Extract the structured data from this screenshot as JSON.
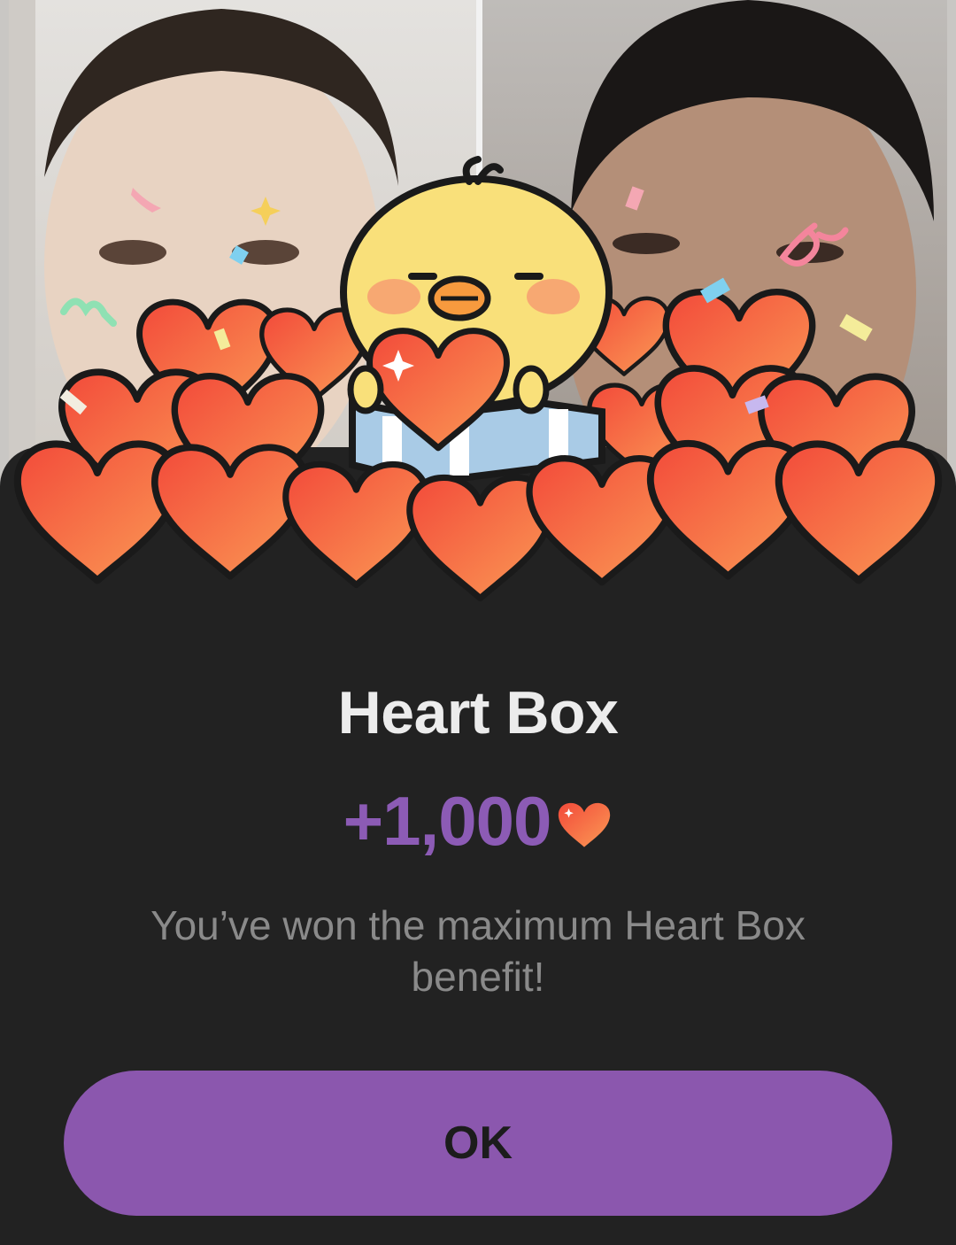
{
  "dialog": {
    "title": "Heart Box",
    "reward_amount": "+1,000",
    "message": "You’ve won the maximum Heart Box benefit!",
    "ok_label": "OK"
  },
  "icons": {
    "reward_currency": "heart-icon",
    "mascot": "chick-mascot-icon"
  },
  "colors": {
    "accent": "#8b57ae",
    "reward_text": "#8c5bb5",
    "sheet_background": "#222222",
    "heart": "#f2643c"
  }
}
